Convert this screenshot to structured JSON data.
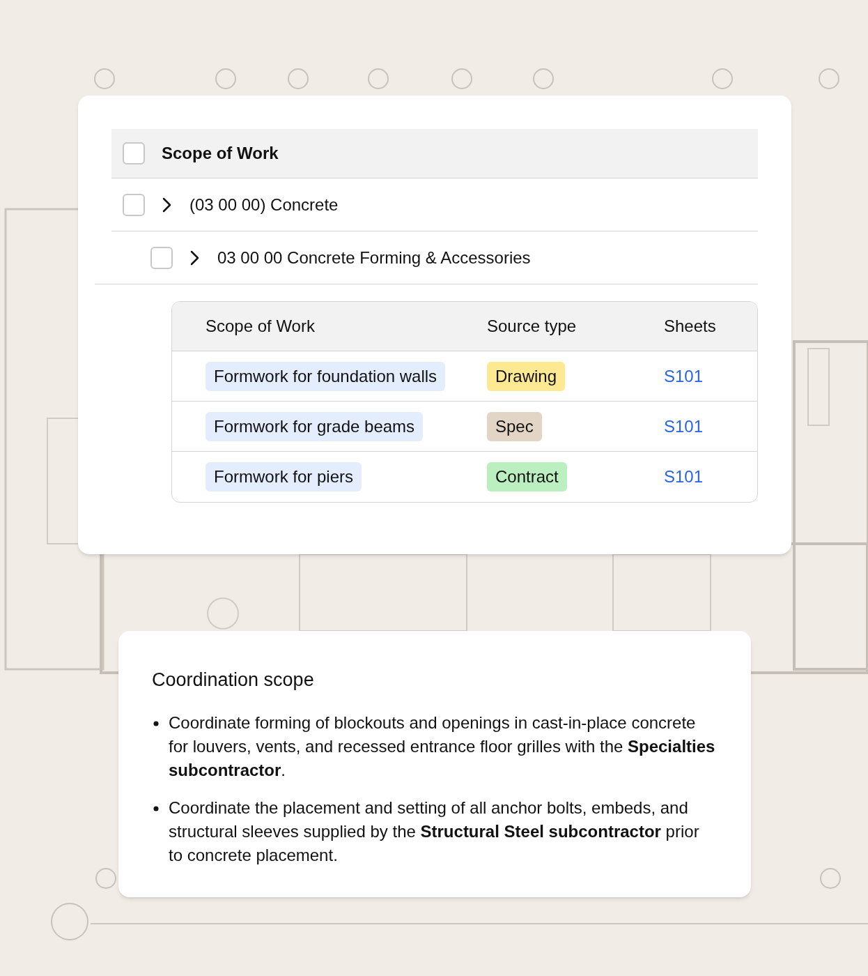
{
  "tree": {
    "header": {
      "label": "Scope of Work",
      "checked": false
    },
    "items": [
      {
        "label": "(03 00 00) Concrete",
        "checked": false,
        "expanded": false,
        "children": [
          {
            "label": "03 00 00 Concrete Forming & Accessories",
            "checked": false,
            "expanded": false
          }
        ]
      }
    ]
  },
  "table": {
    "columns": [
      "Scope of Work",
      "Source type",
      "Sheets"
    ],
    "rows": [
      {
        "scope": "Formwork for foundation walls",
        "source": "Drawing",
        "color": "#fde992",
        "sheet": "S101"
      },
      {
        "scope": "Formwork for grade beams",
        "source": "Spec",
        "color": "#e3d5c6",
        "sheet": "S101"
      },
      {
        "scope": "Formwork for piers",
        "source": "Contract",
        "color": "#bbefbf",
        "sheet": "S101"
      }
    ]
  },
  "notes": {
    "title": "Coordination scope",
    "items": [
      "Coordinate forming of blockouts and openings in cast-in-place concrete for louvers, vents, and recessed entrance floor grilles with the **Specialties subcontractor**.",
      "Coordinate the placement and setting of all anchor bolts, embeds, and structural sleeves supplied by the **Structural Steel subcontractor** prior to concrete placement."
    ]
  }
}
